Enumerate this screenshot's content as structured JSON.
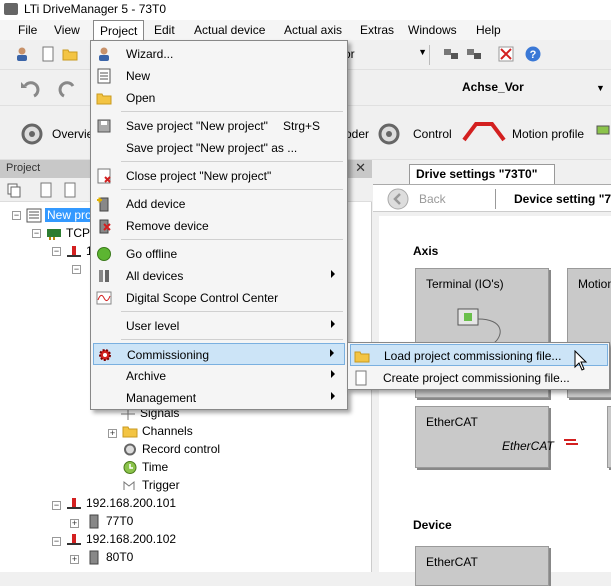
{
  "window": {
    "title": "LTi DriveManager 5 - 73T0"
  },
  "menubar": {
    "items": [
      "File",
      "View",
      "Project",
      "Edit",
      "Actual device",
      "Actual axis",
      "Extras",
      "Windows",
      "Help"
    ]
  },
  "toolbar": {
    "combo_partial": "ator",
    "axis_combo": "Achse_Vor",
    "overview_label": "Overvie",
    "encoder_partial": "oder",
    "control_label": "Control",
    "motion_profile_label": "Motion profile"
  },
  "project_menu": {
    "items": {
      "wizard": "Wizard...",
      "new": "New",
      "open": "Open",
      "save": "Save project \"New project\"",
      "save_shortcut": "Strg+S",
      "save_as": "Save project \"New project\" as ...",
      "close": "Close project \"New project\"",
      "add_device": "Add device",
      "remove_device": "Remove device",
      "go_offline": "Go offline",
      "all_devices": "All devices",
      "scope": "Digital Scope Control Center",
      "user_level": "User level",
      "commissioning": "Commissioning",
      "archive": "Archive",
      "management": "Management"
    }
  },
  "commissioning_submenu": {
    "load": "Load project commissioning file...",
    "create": "Create project commissioning file..."
  },
  "project_panel": {
    "title": "Project",
    "tree": {
      "root": "New proj",
      "tcp": "TCP",
      "one": "1",
      "signals": "Signals",
      "channels": "Channels",
      "record_control": "Record control",
      "time": "Time",
      "trigger": "Trigger",
      "ip101": "192.168.200.101",
      "dev77": "77T0",
      "ip102": "192.168.200.102",
      "dev80": "80T0"
    }
  },
  "right_panel": {
    "tab_title": "Drive settings \"73T0\"",
    "back_label": "Back",
    "device_setting": "Device setting \"7",
    "axis_title": "Axis",
    "terminal_tile": "Terminal (IO's)",
    "motion_tile": "Motion",
    "ethercat_tile": "EtherCAT",
    "ethercat_logo": "EtherCAT",
    "device_title": "Device",
    "ethercat_tile2": "EtherCAT"
  },
  "colors": {
    "highlight": "#cce4f7",
    "selection": "#3399ff",
    "accent_red": "#d32020"
  }
}
